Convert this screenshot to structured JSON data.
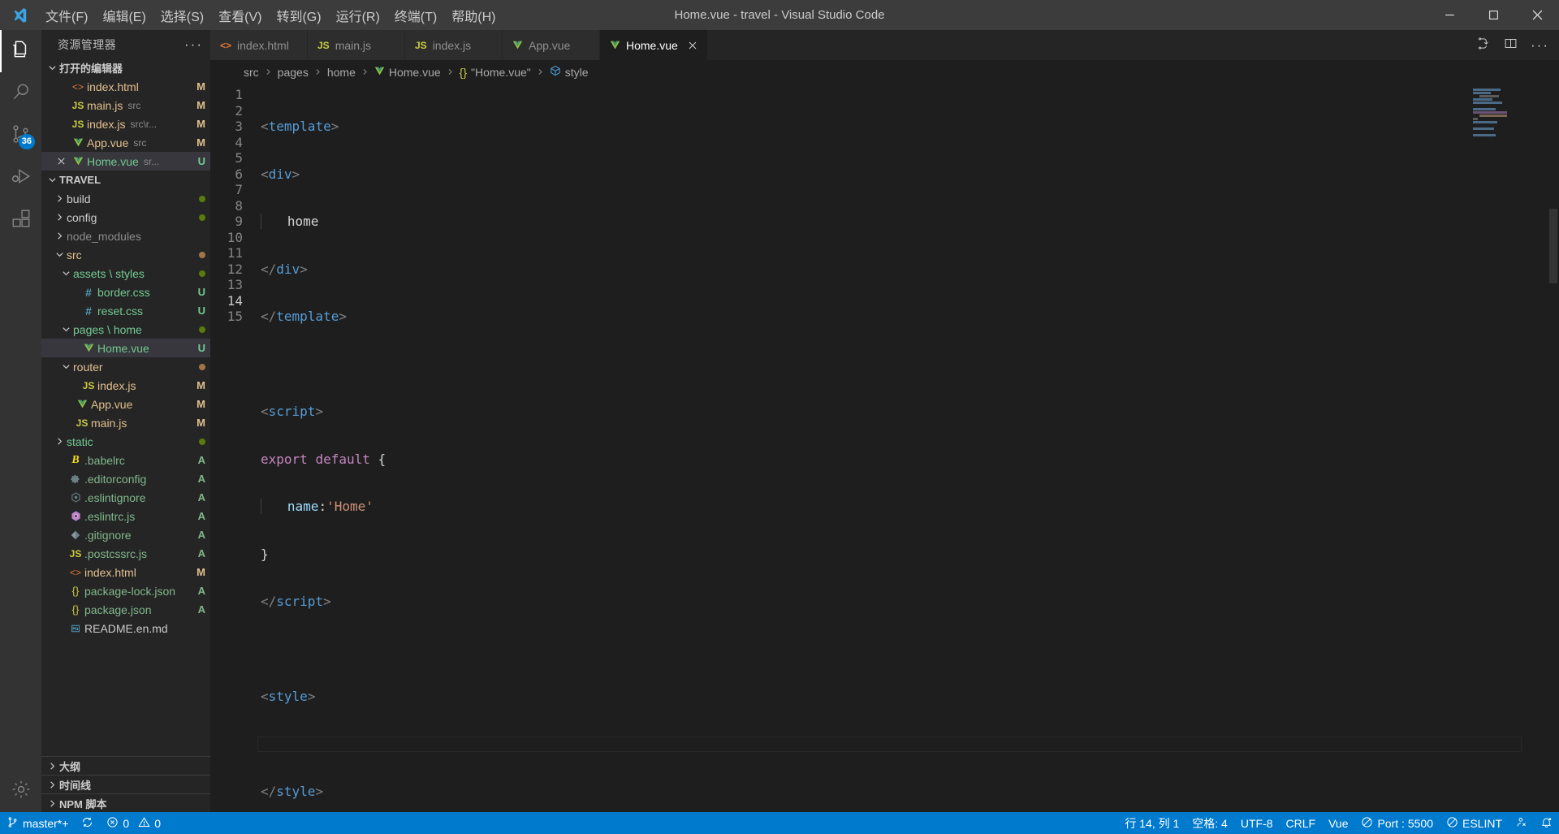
{
  "window": {
    "title": "Home.vue - travel - Visual Studio Code",
    "logo_icon": "vscode-logo-icon",
    "minimize_icon": "minimize-icon",
    "maximize_icon": "maximize-icon",
    "close_icon": "close-icon"
  },
  "menubar": {
    "items": [
      {
        "label": "文件(F)",
        "name": "menu-file"
      },
      {
        "label": "编辑(E)",
        "name": "menu-edit"
      },
      {
        "label": "选择(S)",
        "name": "menu-selection"
      },
      {
        "label": "查看(V)",
        "name": "menu-view"
      },
      {
        "label": "转到(G)",
        "name": "menu-go"
      },
      {
        "label": "运行(R)",
        "name": "menu-run"
      },
      {
        "label": "终端(T)",
        "name": "menu-terminal"
      },
      {
        "label": "帮助(H)",
        "name": "menu-help"
      }
    ]
  },
  "activitybar": {
    "items": [
      {
        "icon": "files-explorer-icon",
        "active": true,
        "badge": ""
      },
      {
        "icon": "search-icon",
        "active": false,
        "badge": ""
      },
      {
        "icon": "source-control-icon",
        "active": false,
        "badge": "36"
      },
      {
        "icon": "run-debug-icon",
        "active": false,
        "badge": ""
      },
      {
        "icon": "extensions-icon",
        "active": false,
        "badge": ""
      }
    ],
    "bottom": [
      {
        "icon": "settings-gear-icon",
        "badge": ""
      }
    ]
  },
  "sidebar": {
    "title": "资源管理器",
    "more_actions": "···",
    "open_editors": {
      "label": "打开的编辑器",
      "items": [
        {
          "name": "index.html",
          "desc": "",
          "badge": "M",
          "icon": "html-icon",
          "state": "M",
          "closable": false,
          "selected": false
        },
        {
          "name": "main.js",
          "desc": "src",
          "badge": "M",
          "icon": "js-icon",
          "state": "M",
          "closable": false,
          "selected": false
        },
        {
          "name": "index.js",
          "desc": "src\\r...",
          "badge": "M",
          "icon": "js-icon",
          "state": "M",
          "closable": false,
          "selected": false
        },
        {
          "name": "App.vue",
          "desc": "src",
          "badge": "M",
          "icon": "vue-icon",
          "state": "M",
          "closable": false,
          "selected": false
        },
        {
          "name": "Home.vue",
          "desc": "sr...",
          "badge": "U",
          "icon": "vue-icon",
          "state": "U",
          "closable": true,
          "selected": true
        }
      ]
    },
    "project": {
      "label": "TRAVEL",
      "items": [
        {
          "name": "build",
          "indent": 1,
          "badge": "",
          "icon": "folder-icon",
          "state": "N",
          "arrow": "right",
          "dot": "#587c0c"
        },
        {
          "name": "config",
          "indent": 1,
          "badge": "",
          "icon": "folder-icon",
          "state": "N",
          "arrow": "right",
          "dot": "#587c0c"
        },
        {
          "name": "node_modules",
          "indent": 1,
          "badge": "",
          "icon": "folder-icon",
          "state": "G",
          "arrow": "right",
          "dot": ""
        },
        {
          "name": "src",
          "indent": 1,
          "badge": "",
          "icon": "folder-icon",
          "state": "M",
          "arrow": "down",
          "dot": "#a1754a"
        },
        {
          "name": "assets \\ styles",
          "indent": 2,
          "badge": "",
          "icon": "folder-icon",
          "state": "U",
          "arrow": "down",
          "dot": "#587c0c"
        },
        {
          "name": "border.css",
          "indent": 3,
          "badge": "U",
          "icon": "css-icon",
          "state": "U",
          "arrow": "",
          "dot": ""
        },
        {
          "name": "reset.css",
          "indent": 3,
          "badge": "U",
          "icon": "css-icon",
          "state": "U",
          "arrow": "",
          "dot": ""
        },
        {
          "name": "pages \\ home",
          "indent": 2,
          "badge": "",
          "icon": "folder-icon",
          "state": "U",
          "arrow": "down",
          "dot": "#587c0c"
        },
        {
          "name": "Home.vue",
          "indent": 3,
          "badge": "U",
          "icon": "vue-icon",
          "state": "U",
          "arrow": "",
          "dot": "",
          "selected": true
        },
        {
          "name": "router",
          "indent": 2,
          "badge": "",
          "icon": "folder-icon",
          "state": "M",
          "arrow": "down",
          "dot": "#a1754a"
        },
        {
          "name": "index.js",
          "indent": 3,
          "badge": "M",
          "icon": "js-icon",
          "state": "M",
          "arrow": "",
          "dot": ""
        },
        {
          "name": "App.vue",
          "indent": 2,
          "badge": "M",
          "icon": "vue-icon",
          "state": "M",
          "arrow": "",
          "dot": ""
        },
        {
          "name": "main.js",
          "indent": 2,
          "badge": "M",
          "icon": "js-icon",
          "state": "M",
          "arrow": "",
          "dot": ""
        },
        {
          "name": "static",
          "indent": 1,
          "badge": "",
          "icon": "folder-icon",
          "state": "U",
          "arrow": "right",
          "dot": "#587c0c"
        },
        {
          "name": ".babelrc",
          "indent": 1,
          "badge": "A",
          "icon": "babel-icon",
          "state": "A",
          "arrow": "",
          "dot": ""
        },
        {
          "name": ".editorconfig",
          "indent": 1,
          "badge": "A",
          "icon": "gear-icon",
          "state": "A",
          "arrow": "",
          "dot": ""
        },
        {
          "name": ".eslintignore",
          "indent": 1,
          "badge": "A",
          "icon": "eslint-gray-icon",
          "state": "A",
          "arrow": "",
          "dot": ""
        },
        {
          "name": ".eslintrc.js",
          "indent": 1,
          "badge": "A",
          "icon": "eslint-icon",
          "state": "A",
          "arrow": "",
          "dot": ""
        },
        {
          "name": ".gitignore",
          "indent": 1,
          "badge": "A",
          "icon": "git-icon",
          "state": "A",
          "arrow": "",
          "dot": ""
        },
        {
          "name": ".postcssrc.js",
          "indent": 1,
          "badge": "A",
          "icon": "js-icon",
          "state": "A",
          "arrow": "",
          "dot": ""
        },
        {
          "name": "index.html",
          "indent": 1,
          "badge": "M",
          "icon": "html-icon",
          "state": "M",
          "arrow": "",
          "dot": ""
        },
        {
          "name": "package-lock.json",
          "indent": 1,
          "badge": "A",
          "icon": "json-icon",
          "state": "A",
          "arrow": "",
          "dot": ""
        },
        {
          "name": "package.json",
          "indent": 1,
          "badge": "A",
          "icon": "json-icon",
          "state": "A",
          "arrow": "",
          "dot": ""
        },
        {
          "name": "README.en.md",
          "indent": 1,
          "badge": "",
          "icon": "markdown-icon",
          "state": "N",
          "arrow": "",
          "dot": ""
        }
      ]
    },
    "panels": [
      {
        "label": "大纲",
        "name": "panel-outline"
      },
      {
        "label": "时间线",
        "name": "panel-timeline"
      },
      {
        "label": "NPM 脚本",
        "name": "panel-npm-scripts"
      }
    ]
  },
  "editor": {
    "tabs": [
      {
        "label": "index.html",
        "icon": "html-icon",
        "active": false,
        "closable": false
      },
      {
        "label": "main.js",
        "icon": "js-icon",
        "active": false,
        "closable": false
      },
      {
        "label": "index.js",
        "icon": "js-icon",
        "active": false,
        "closable": false
      },
      {
        "label": "App.vue",
        "icon": "vue-icon",
        "active": false,
        "closable": false
      },
      {
        "label": "Home.vue",
        "icon": "vue-icon",
        "active": true,
        "closable": true
      }
    ],
    "tab_actions": [
      {
        "icon": "split-editor-down-icon"
      },
      {
        "icon": "split-editor-right-icon"
      },
      {
        "icon": "more-actions-icon"
      }
    ],
    "breadcrumb": [
      {
        "label": "src",
        "icon": ""
      },
      {
        "label": "pages",
        "icon": ""
      },
      {
        "label": "home",
        "icon": ""
      },
      {
        "label": "Home.vue",
        "icon": "vue-icon"
      },
      {
        "label": "\"Home.vue\"",
        "icon": "json-brace-icon"
      },
      {
        "label": "style",
        "icon": "symbol-namespace-icon"
      }
    ],
    "lines": [
      {
        "n": 1,
        "current": false
      },
      {
        "n": 2,
        "current": false
      },
      {
        "n": 3,
        "current": false
      },
      {
        "n": 4,
        "current": false
      },
      {
        "n": 5,
        "current": false
      },
      {
        "n": 6,
        "current": false
      },
      {
        "n": 7,
        "current": false
      },
      {
        "n": 8,
        "current": false
      },
      {
        "n": 9,
        "current": false
      },
      {
        "n": 10,
        "current": false
      },
      {
        "n": 11,
        "current": false
      },
      {
        "n": 12,
        "current": false
      },
      {
        "n": 13,
        "current": false
      },
      {
        "n": 14,
        "current": true
      },
      {
        "n": 15,
        "current": false
      }
    ],
    "source_text": [
      "<template>",
      "<div>",
      "    home",
      "</div>",
      "</template>",
      "",
      "<script>",
      "export default {",
      "    name:'Home'",
      "}",
      "</script>",
      "",
      "<style>",
      "",
      "</style>"
    ]
  },
  "statusbar": {
    "left": [
      {
        "icon": "source-control-branch-icon",
        "label": "master*+",
        "name": "status-branch"
      },
      {
        "icon": "sync-icon",
        "label": "",
        "name": "status-sync"
      },
      {
        "icon": "error-icon",
        "label": "0",
        "name": "status-errors",
        "second_icon": "warning-icon",
        "second_label": "0"
      }
    ],
    "right": [
      {
        "icon": "",
        "label": "行 14, 列 1",
        "name": "status-line-col"
      },
      {
        "icon": "",
        "label": "空格: 4",
        "name": "status-indentation"
      },
      {
        "icon": "",
        "label": "UTF-8",
        "name": "status-encoding"
      },
      {
        "icon": "",
        "label": "CRLF",
        "name": "status-eol"
      },
      {
        "icon": "",
        "label": "Vue",
        "name": "status-language-mode"
      },
      {
        "icon": "circle-slash-icon",
        "label": "Port : 5500",
        "name": "status-live-server"
      },
      {
        "icon": "circle-slash-icon",
        "label": "ESLINT",
        "name": "status-eslint"
      },
      {
        "icon": "feedback-icon",
        "label": "",
        "name": "status-feedback"
      },
      {
        "icon": "bell-dot-icon",
        "label": "",
        "name": "status-notifications"
      }
    ]
  },
  "colors": {
    "accent": "#007acc",
    "titlebar_bg": "#3c3c3c",
    "activitybar_bg": "#333333",
    "sidebar_bg": "#252526",
    "editor_bg": "#1e1e1e",
    "tab_active_bg": "#1e1e1e",
    "tab_inactive_bg": "#2d2d2d",
    "row_selected_bg": "#37373d",
    "badge_modified": "#e2c08d",
    "badge_untracked": "#73c991",
    "badge_added": "#81b88b"
  }
}
